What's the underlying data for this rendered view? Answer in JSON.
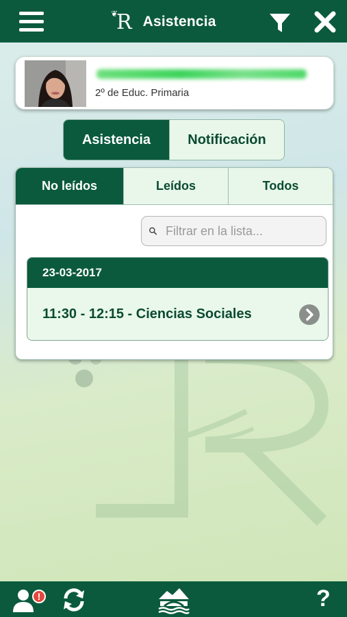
{
  "header": {
    "logo_letter": "R",
    "title": "Asistencia"
  },
  "student": {
    "course": "2º de Educ. Primaria"
  },
  "segment": {
    "active": "Asistencia",
    "inactive": "Notificación"
  },
  "tabs": [
    {
      "label": "No leídos"
    },
    {
      "label": "Leídos"
    },
    {
      "label": "Todos"
    }
  ],
  "search": {
    "placeholder": "Filtrar en la lista..."
  },
  "list": {
    "date": "23-03-2017",
    "item": "11:30 - 12:15 - Ciencias Sociales"
  },
  "bottom": {
    "help_label": "?",
    "alert_badge": "!"
  },
  "colors": {
    "primary": "#0b5a3e",
    "tab_inactive_bg": "#e8f7ea",
    "badge": "#e4473c"
  }
}
